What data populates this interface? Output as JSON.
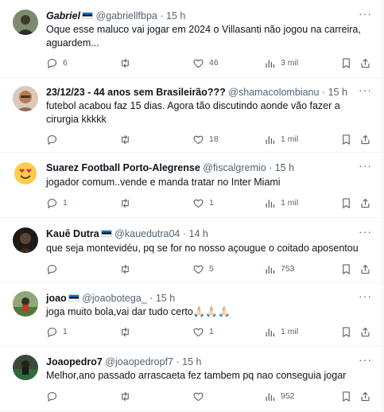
{
  "feed": {
    "tweets": [
      {
        "name": "Gabriel",
        "handle": "@gabriellfbpa",
        "dot": "·",
        "time": "15 h",
        "text": "Oque esse maluco vai jogar em 2024 o Villasanti não jogou na carreira, aguardem...",
        "replies": "6",
        "retweets": "",
        "likes": "46",
        "views": "3 mil",
        "avatar_color": "#4a5a3a"
      },
      {
        "name": "23/12/23 - 44 anos sem Brasileirão???",
        "handle": "@shamacolombianu",
        "dot": "·",
        "time": "15 h",
        "text": "futebol acabou faz 15 dias. Agora tão discutindo aonde vão fazer a cirurgia kkkkk",
        "replies": "",
        "retweets": "",
        "likes": "18",
        "views": "1 mil",
        "avatar_color": "#b97a5a"
      },
      {
        "name": "Suarez Football Porto-Alegrense",
        "handle": "@fiscalgremio",
        "dot": "·",
        "time": "15 h",
        "text": "jogador comum..vende e manda tratar no Inter Miami",
        "replies": "1",
        "retweets": "",
        "likes": "1",
        "views": "1 mil",
        "avatar_color": "#ffcc4d"
      },
      {
        "name": "Kauê Dutra",
        "handle": "@kauedutra04",
        "dot": "·",
        "time": "14 h",
        "text": "que seja montevidéu, pq se for no nosso açougue o coitado aposentou",
        "replies": "",
        "retweets": "",
        "likes": "5",
        "views": "753",
        "avatar_color": "#3a2e24"
      },
      {
        "name": "joao",
        "handle": "@joaobotega_",
        "dot": "·",
        "time": "15 h",
        "text": "joga muito bola,vai dar tudo certo🙏🏻🙏🏻🙏🏻",
        "replies": "1",
        "retweets": "",
        "likes": "1",
        "views": "1 mil",
        "avatar_color": "#5d7a4a"
      },
      {
        "name": "Joaopedro7",
        "handle": "@joaopedropf7",
        "dot": "·",
        "time": "15 h",
        "text": "Melhor,ano passado arrascaeta fez tambem pq nao conseguia jogar",
        "replies": "",
        "retweets": "",
        "likes": "",
        "views": "952",
        "avatar_color": "#2f4f3a"
      }
    ]
  }
}
